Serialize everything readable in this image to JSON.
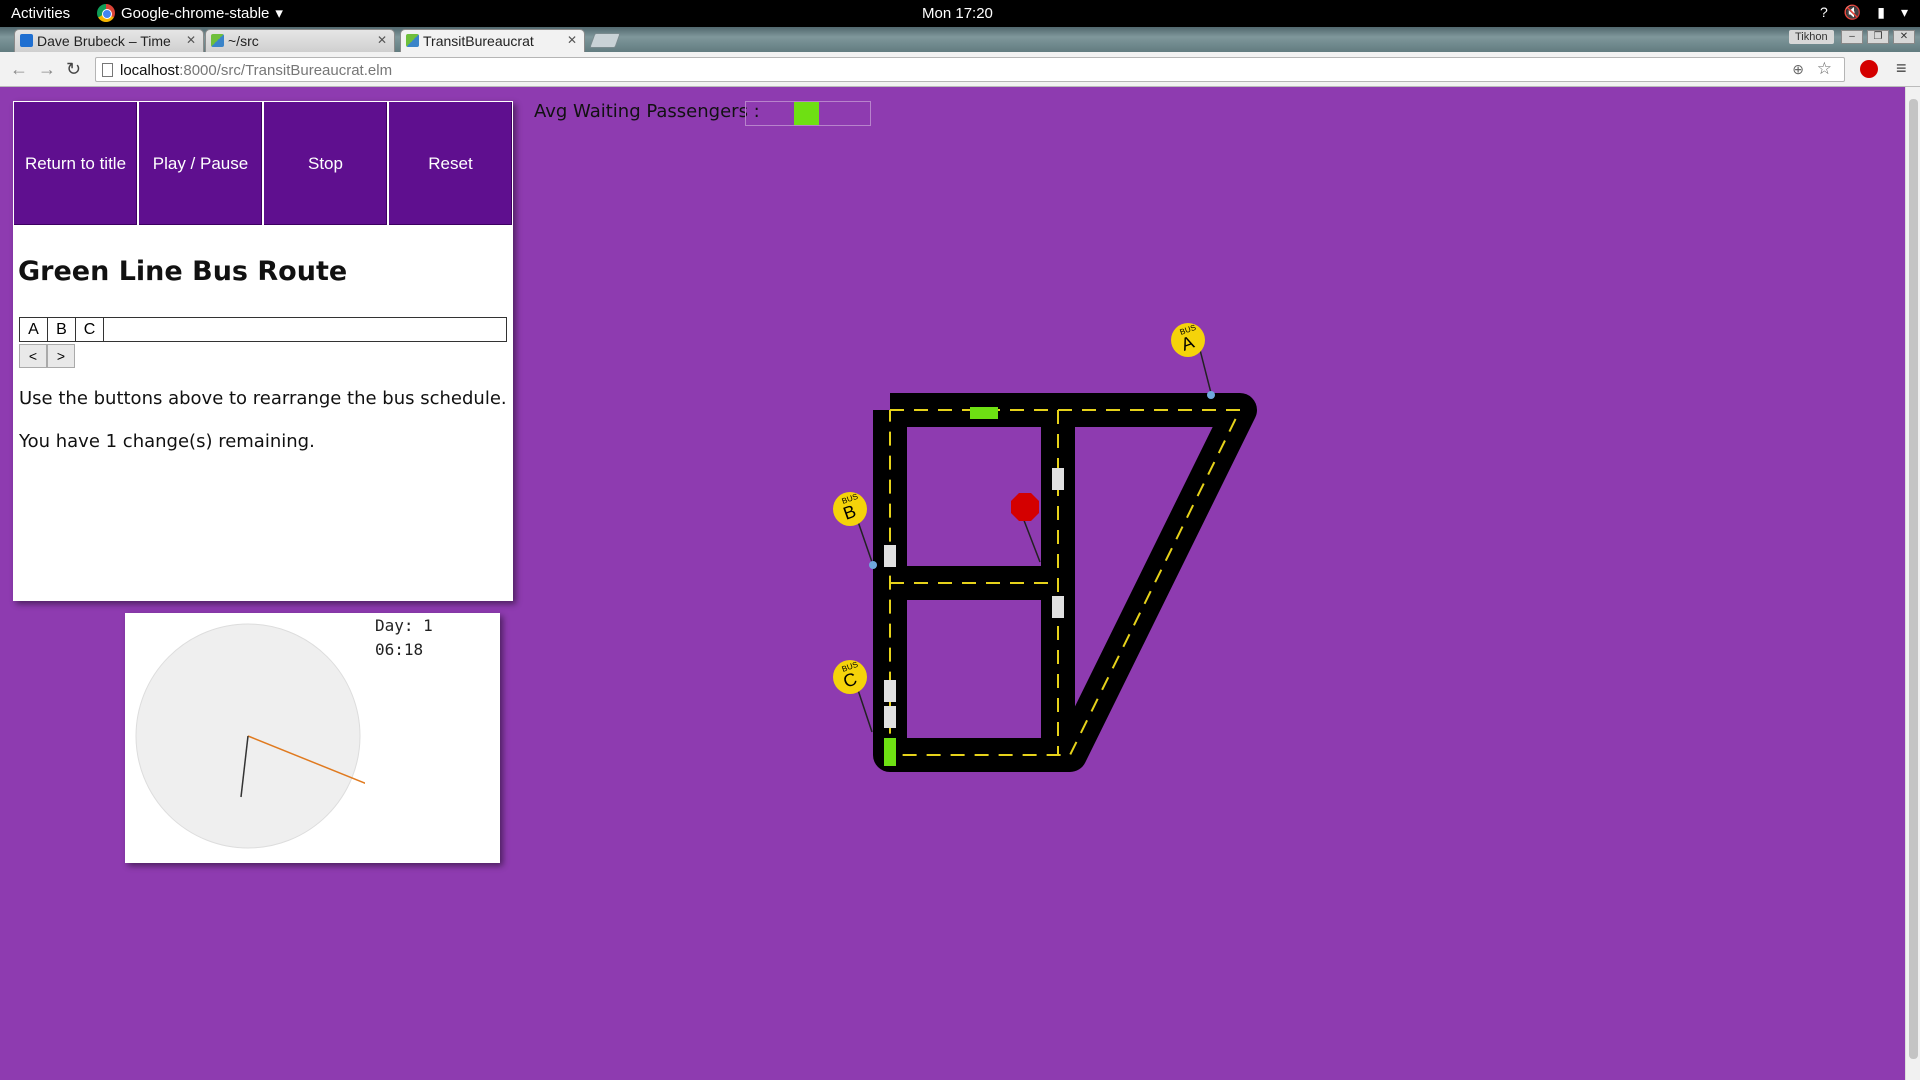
{
  "system": {
    "activities": "Activities",
    "app_name": "Google-chrome-stable",
    "clock": "Mon 17:20",
    "window_user": "Tikhon"
  },
  "browser": {
    "tabs": [
      {
        "title": "Dave Brubeck – Time"
      },
      {
        "title": "~/src"
      },
      {
        "title": "TransitBureaucrat"
      }
    ],
    "url_host": "localhost",
    "url_path": ":8000/src/TransitBureaucrat.elm"
  },
  "controls": {
    "return_label": "Return to title",
    "play_label": "Play / Pause",
    "stop_label": "Stop",
    "reset_label": "Reset"
  },
  "route": {
    "title": "Green Line Bus Route",
    "schedule": [
      "A",
      "B",
      "C"
    ],
    "prev_label": "<",
    "next_label": ">",
    "instructions": "Use the buttons above to rearrange the bus schedule.",
    "changes": "You have 1 change(s) remaining."
  },
  "clock": {
    "day": "Day: 1",
    "time": "06:18"
  },
  "waiting": {
    "label": "Avg Waiting Passengers :",
    "level_fraction": 0.2,
    "color": "#6ee013"
  },
  "map": {
    "stops": [
      {
        "label": "A",
        "tag": "BUS"
      },
      {
        "label": "B",
        "tag": "BUS"
      },
      {
        "label": "C",
        "tag": "BUS"
      }
    ],
    "colors": {
      "road": "#000000",
      "lane": "#e6d21a",
      "stop": "#f5d30a",
      "stop_sign": "#d40000",
      "bus_green": "#6ee013",
      "car": "#e0e0e0"
    }
  }
}
